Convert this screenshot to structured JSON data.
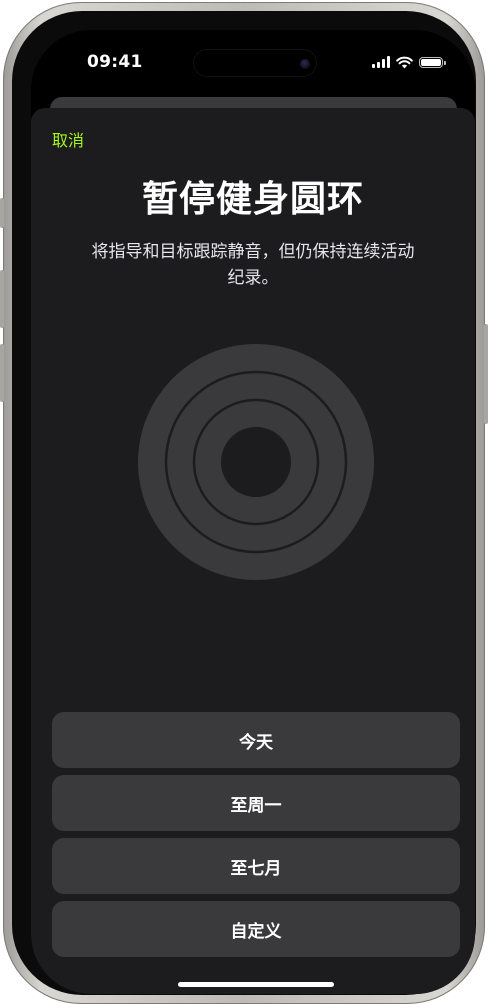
{
  "status_bar": {
    "time": "09:41"
  },
  "sheet": {
    "cancel_label": "取消",
    "title": "暂停健身圆环",
    "subtitle": "将指导和目标跟踪静音，但仍保持连续活动纪录。"
  },
  "options": [
    {
      "label": "今天"
    },
    {
      "label": "至周一"
    },
    {
      "label": "至七月"
    },
    {
      "label": "自定义"
    }
  ],
  "colors": {
    "accent": "#a6f71b",
    "sheet_background": "#1c1c1e",
    "button_background": "#3a3a3c",
    "ring_fill": "#3a3a3c"
  },
  "icons": {
    "signal": "cellular-signal-icon",
    "wifi": "wifi-icon",
    "battery": "battery-icon",
    "rings": "activity-rings-icon"
  }
}
